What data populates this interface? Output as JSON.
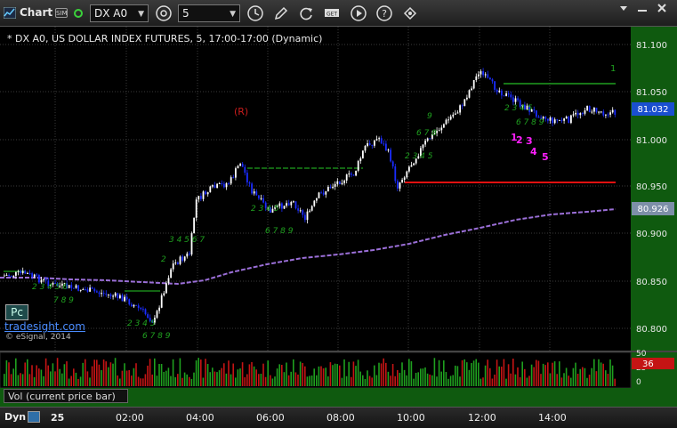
{
  "toolbar": {
    "title": "Chart",
    "symbol": "DX A0",
    "interval": "5",
    "badge": "SIM"
  },
  "chart_info": "* DX A0, US DOLLAR INDEX FUTURES, 5, 17:00-17:00 (Dynamic)",
  "overlay": {
    "pc_label": "Pc",
    "brand": "tradesight.com",
    "copyright": "© eSignal, 2014",
    "r_marker": "(R)",
    "vol_label": "Vol (current price bar)"
  },
  "price_axis": {
    "ticks": [
      "81.100",
      "81.050",
      "81.000",
      "80.950",
      "80.900",
      "80.850",
      "80.800"
    ],
    "current_price": "81.032",
    "ma_value": "80.926"
  },
  "volume_axis": {
    "ticks": [
      "50",
      "25",
      "0"
    ],
    "current": "36"
  },
  "time_axis": {
    "mode": "Dyn",
    "ticks": [
      "25",
      "02:00",
      "04:00",
      "06:00",
      "08:00",
      "10:00",
      "12:00",
      "14:00"
    ]
  },
  "counts": {
    "magenta": [
      "1",
      "2",
      "3",
      "4",
      "5"
    ],
    "green_topright": "1"
  },
  "colors": {
    "up_bar": "#ffffff",
    "down_bar": "#1a2cff",
    "ma_line": "#9b6fd8",
    "support_line": "#e01010",
    "resistance_line": "#1fa01f",
    "current_price_box": "#1a4fd0",
    "ma_box": "#7d8fa8",
    "volume_up": "#1fa01f",
    "volume_down": "#c41414",
    "magenta_count": "#ff1fff"
  }
}
